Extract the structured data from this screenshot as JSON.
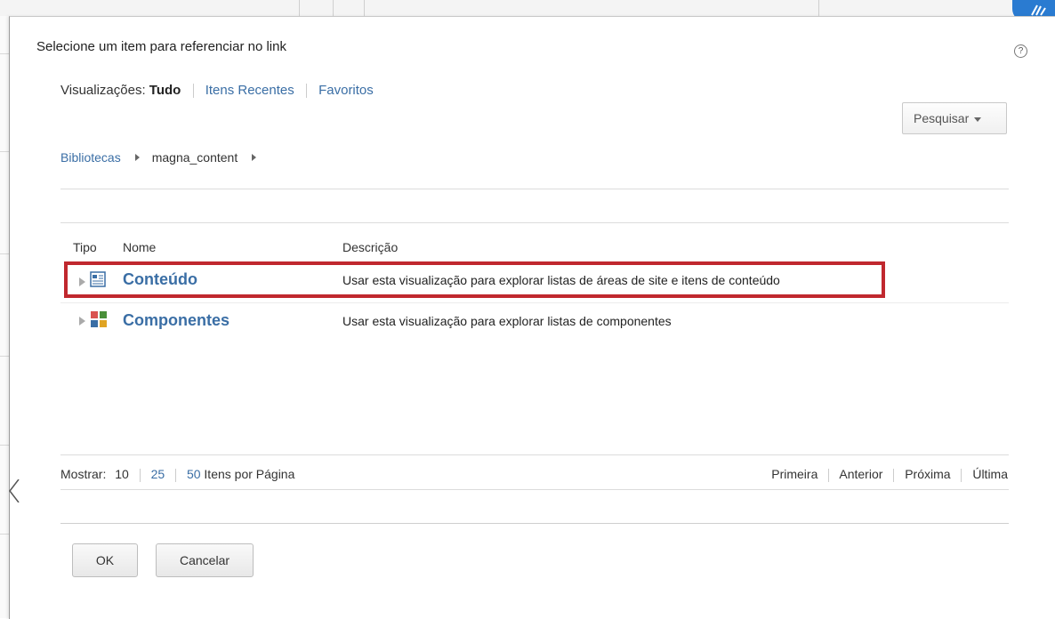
{
  "dialog": {
    "title": "Selecione um item para referenciar no link",
    "help_icon": "help-icon",
    "help_glyph": "?"
  },
  "views": {
    "label": "Visualizações:",
    "current": "Tudo",
    "recent": "Itens Recentes",
    "favorites": "Favoritos"
  },
  "search": {
    "label": "Pesquisar"
  },
  "breadcrumb": {
    "root": "Bibliotecas",
    "current": "magna_content"
  },
  "table": {
    "headers": {
      "type": "Tipo",
      "name": "Nome",
      "description": "Descrição"
    },
    "rows": [
      {
        "name": "Conteúdo",
        "description": "Usar esta visualização para explorar listas de áreas de site e itens de conteúdo",
        "icon": "content-icon",
        "highlighted": true
      },
      {
        "name": "Componentes",
        "description": "Usar esta visualização para explorar listas de componentes",
        "icon": "components-icon",
        "highlighted": false
      }
    ]
  },
  "pager": {
    "show_label": "Mostrar:",
    "sizes": [
      "10",
      "25",
      "50"
    ],
    "per_page_label": "Itens por Página",
    "first": "Primeira",
    "previous": "Anterior",
    "next": "Próxima",
    "last": "Última"
  },
  "buttons": {
    "ok": "OK",
    "cancel": "Cancelar"
  },
  "colors": {
    "link": "#3a6ea5",
    "highlight_border": "#c0282e",
    "badge": "#2a7bd1"
  }
}
